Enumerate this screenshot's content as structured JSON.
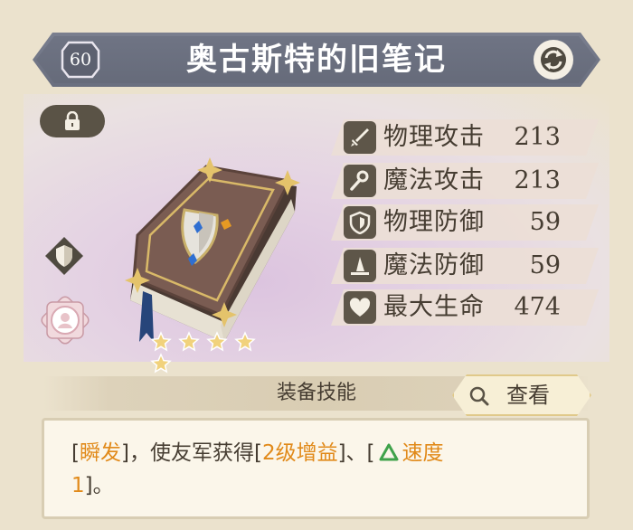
{
  "header": {
    "level": "60",
    "title": "奥古斯特的旧笔记"
  },
  "item": {
    "rarity_stars": 5
  },
  "stats": [
    {
      "name": "物理攻击",
      "value": "213",
      "icon": "sword-icon"
    },
    {
      "name": "魔法攻击",
      "value": "213",
      "icon": "staff-icon"
    },
    {
      "name": "物理防御",
      "value": "59",
      "icon": "shield-icon"
    },
    {
      "name": "魔法防御",
      "value": "59",
      "icon": "wizard-hat-icon"
    },
    {
      "name": "最大生命",
      "value": "474",
      "icon": "heart-icon"
    }
  ],
  "skill": {
    "section_label": "装备技能",
    "view_label": "查看",
    "desc": {
      "p1": "[",
      "kw1": "瞬发",
      "p2": "]，使友军获得[",
      "kw2": "2级增益",
      "p3": "]、[",
      "kw3": "速度",
      "kw4": "1",
      "p4": "]。"
    }
  },
  "colors": {
    "title_bar": "#6f7484",
    "accent": "#e18a1a",
    "buff_icon": "#3fa24a"
  }
}
